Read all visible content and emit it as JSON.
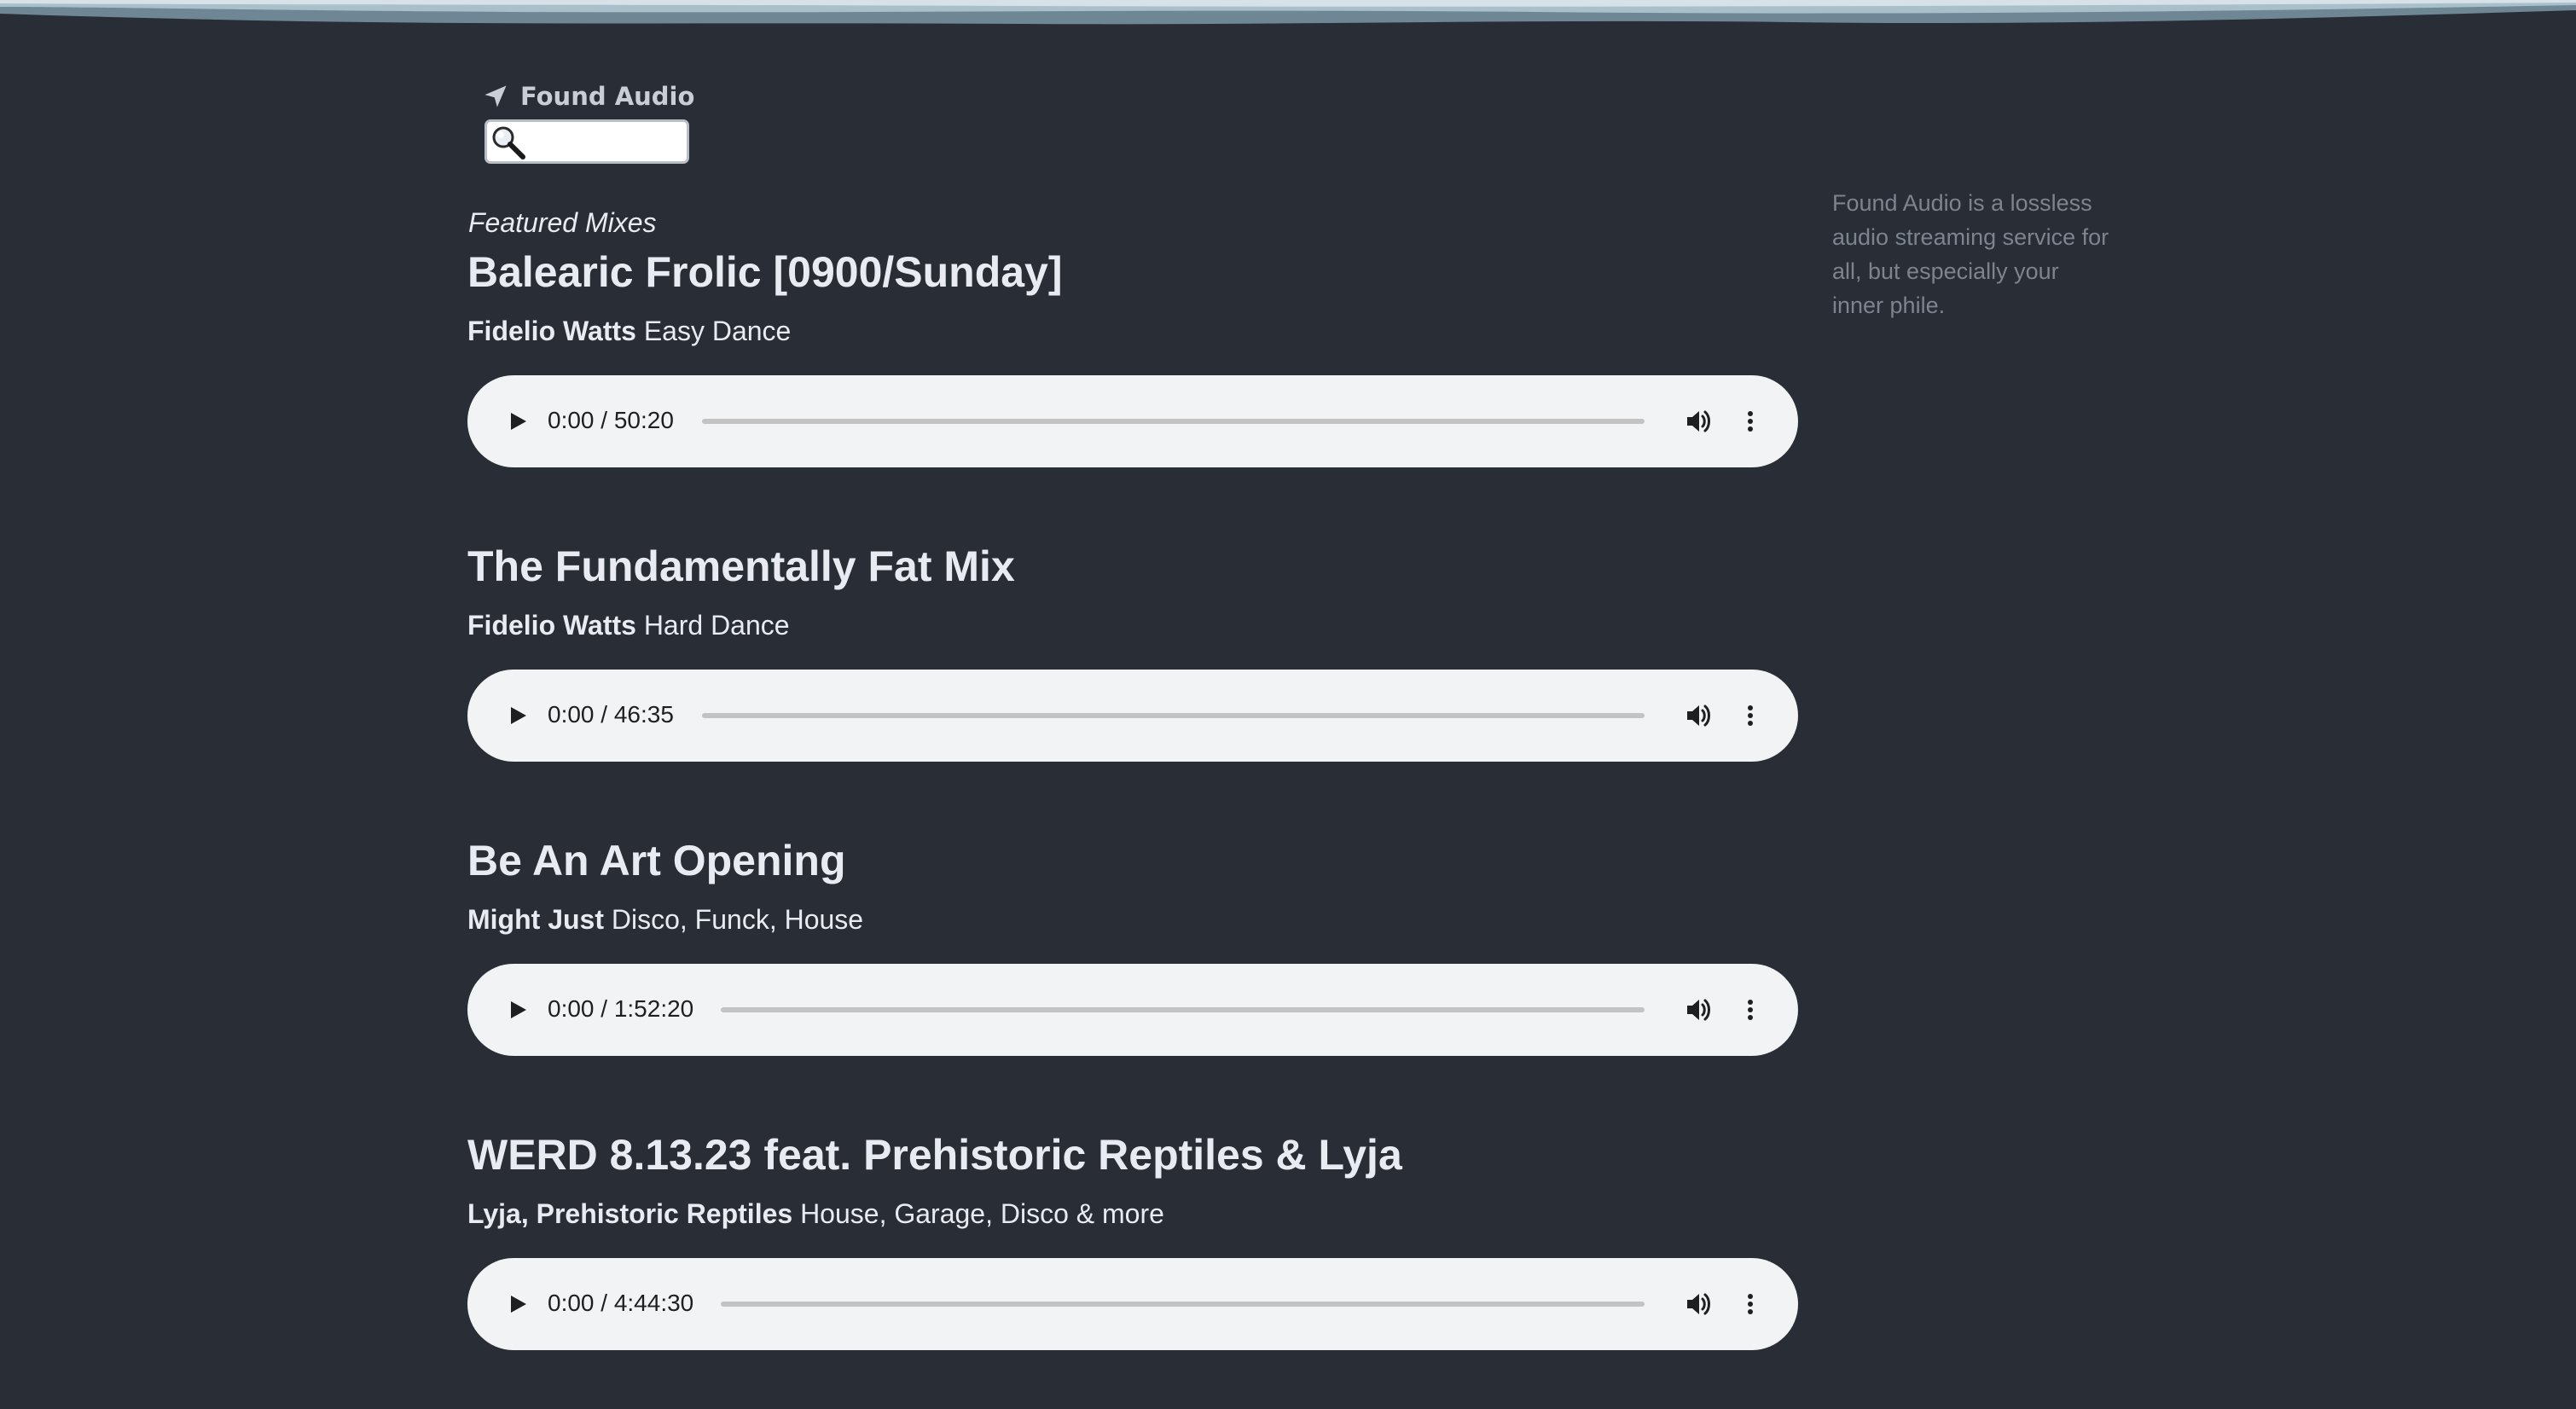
{
  "app": {
    "brand_name": "Found Audio",
    "about": "Found Audio is a lossless audio streaming service for all, but especially your inner phile."
  },
  "search": {
    "value": "",
    "placeholder": ""
  },
  "featured": {
    "heading": "Featured Mixes",
    "mixes": [
      {
        "title": "Balearic Frolic [0900/Sunday]",
        "artist": "Fidelio Watts",
        "genre": "Easy Dance",
        "time": "0:00 / 50:20",
        "progress": 0
      },
      {
        "title": "The Fundamentally Fat Mix",
        "artist": "Fidelio Watts",
        "genre": "Hard Dance",
        "time": "0:00 / 46:35",
        "progress": 0
      },
      {
        "title": "Be An Art Opening",
        "artist": "Might Just",
        "genre": "Disco, Funck, House",
        "time": "0:00 / 1:52:20",
        "progress": 0
      },
      {
        "title": "WERD 8.13.23 feat. Prehistoric Reptiles & Lyja",
        "artist": "Lyja, Prehistoric Reptiles",
        "genre": "House, Garage, Disco & more",
        "time": "0:00 / 4:44:30",
        "progress": 0
      }
    ]
  },
  "colors": {
    "background": "#282d36",
    "player": "#f1f3f4",
    "text": "#e8ecf2",
    "muted_text": "#7e848d"
  }
}
